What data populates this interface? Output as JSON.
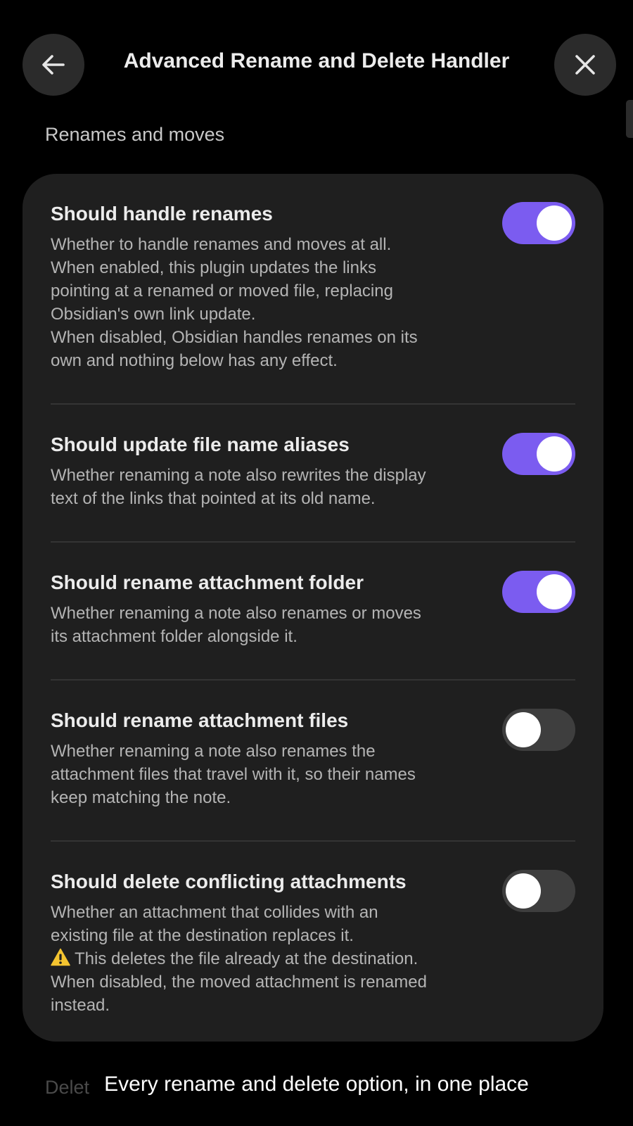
{
  "header": {
    "title": "Advanced Rename and Delete Handler",
    "back_icon": "arrow-left-icon",
    "close_icon": "close-icon"
  },
  "section": {
    "heading": "Renames and moves"
  },
  "settings": [
    {
      "name": "Should handle renames",
      "enabled": true,
      "description": [
        "Whether to handle renames and moves at all.",
        "When enabled, this plugin updates the links",
        "pointing at a renamed or moved file, replacing",
        "Obsidian's own link update.",
        "When disabled, Obsidian handles renames on its",
        "own and nothing below has any effect."
      ]
    },
    {
      "name": "Should update file name aliases",
      "enabled": true,
      "description": [
        "Whether renaming a note also rewrites the display",
        "text of the links that pointed at its old name."
      ]
    },
    {
      "name": "Should rename attachment folder",
      "enabled": true,
      "description": [
        "Whether renaming a note also renames or moves",
        "its attachment folder alongside it."
      ]
    },
    {
      "name": "Should rename attachment files",
      "enabled": false,
      "description": [
        "Whether renaming a note also renames the",
        "attachment files that travel with it, so their names",
        "keep matching the note."
      ]
    },
    {
      "name": "Should delete conflicting attachments",
      "enabled": false,
      "description": [
        "Whether an attachment that collides with an",
        "existing file at the destination replaces it.",
        "This deletes the file already at the destination.",
        "When disabled, the moved attachment is renamed",
        "instead."
      ],
      "warning_icon": "warning-icon"
    }
  ],
  "next_section": {
    "heading_partial": "Delet"
  },
  "caption": "Every rename and delete option, in one place",
  "colors": {
    "accent": "#7b5cf0",
    "card": "#1f1f1f",
    "background": "#000000",
    "warning": "#f4c430"
  }
}
